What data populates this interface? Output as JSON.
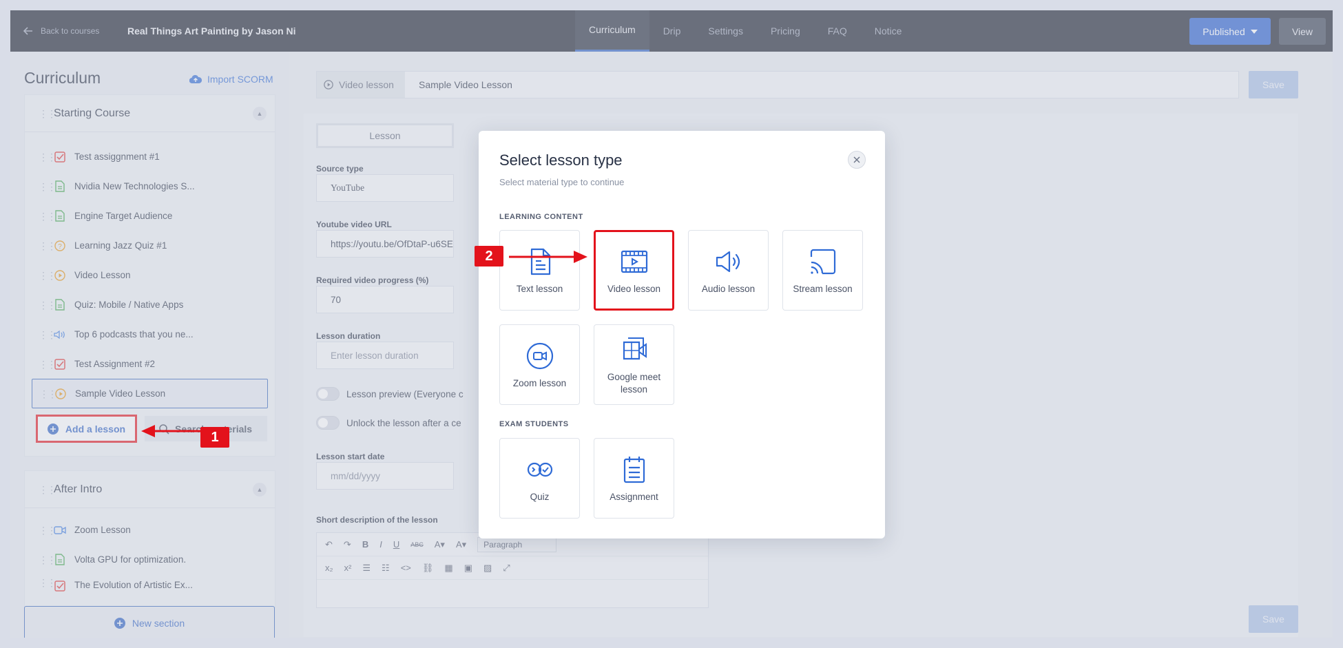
{
  "topbar": {
    "back_label": "Back to courses",
    "course_title": "Real Things Art Painting by Jason Ni",
    "tabs": [
      "Curriculum",
      "Drip",
      "Settings",
      "Pricing",
      "FAQ",
      "Notice"
    ],
    "published_label": "Published",
    "view_label": "View"
  },
  "sidebar": {
    "title": "Curriculum",
    "import_label": "Import SCORM",
    "sections": [
      {
        "title": "Starting Course",
        "lessons": [
          {
            "label": "Test assiggnment #1",
            "icon": "assignment-icon"
          },
          {
            "label": "Nvidia New Technologies S...",
            "icon": "text-file-icon"
          },
          {
            "label": "Engine Target Audience",
            "icon": "text-file-icon"
          },
          {
            "label": "Learning Jazz Quiz #1",
            "icon": "quiz-icon"
          },
          {
            "label": "Video Lesson",
            "icon": "video-icon"
          },
          {
            "label": "Quiz: Mobile / Native Apps",
            "icon": "text-file-icon"
          },
          {
            "label": "Top 6 podcasts that you ne...",
            "icon": "audio-icon"
          },
          {
            "label": "Test Assignment #2",
            "icon": "assignment-icon"
          },
          {
            "label": "Sample Video Lesson",
            "icon": "video-icon"
          }
        ]
      },
      {
        "title": "After Intro",
        "lessons": [
          {
            "label": "Zoom Lesson",
            "icon": "zoom-icon"
          },
          {
            "label": "Volta GPU for optimization.",
            "icon": "text-file-icon"
          },
          {
            "label": "The Evolution of Artistic Ex...",
            "icon": "assignment-icon"
          }
        ]
      }
    ],
    "add_lesson_label": "Add a lesson",
    "search_materials_label": "Search materials",
    "new_section_label": "New section"
  },
  "editor": {
    "type_badge": "Video lesson",
    "lesson_name": "Sample Video Lesson",
    "save_label": "Save",
    "segment_label": "Lesson",
    "source_type_label": "Source type",
    "source_type_value": "YouTube",
    "url_label": "Youtube video URL",
    "url_value": "https://youtu.be/OfDtaP-u6SE",
    "progress_label": "Required video progress (%)",
    "progress_value": "70",
    "duration_label": "Lesson duration",
    "duration_placeholder": "Enter lesson duration",
    "preview_label": "Lesson preview (Everyone c",
    "unlock_label": "Unlock the lesson after a ce",
    "start_date_label": "Lesson start date",
    "start_date_placeholder": "mm/dd/yyyy",
    "short_desc_label": "Short description of the lesson",
    "paragraph_label": "Paragraph"
  },
  "modal": {
    "title": "Select lesson type",
    "subtitle": "Select material type to continue",
    "group_learning": "LEARNING CONTENT",
    "group_exam": "EXAM STUDENTS",
    "learning_types": [
      {
        "label": "Text lesson",
        "icon": "text-lesson-icon"
      },
      {
        "label": "Video lesson",
        "icon": "video-lesson-icon"
      },
      {
        "label": "Audio lesson",
        "icon": "audio-lesson-icon"
      },
      {
        "label": "Stream lesson",
        "icon": "stream-lesson-icon"
      },
      {
        "label": "Zoom lesson",
        "icon": "zoom-lesson-icon"
      },
      {
        "label": "Google meet lesson",
        "icon": "google-meet-icon"
      }
    ],
    "exam_types": [
      {
        "label": "Quiz",
        "icon": "quiz-type-icon"
      },
      {
        "label": "Assignment",
        "icon": "assignment-type-icon"
      }
    ]
  },
  "annotations": {
    "step1": "1",
    "step2": "2"
  },
  "colors": {
    "accent": "#2a5fc4",
    "highlight": "#e3121b",
    "topbar": "#1a1f2e"
  }
}
